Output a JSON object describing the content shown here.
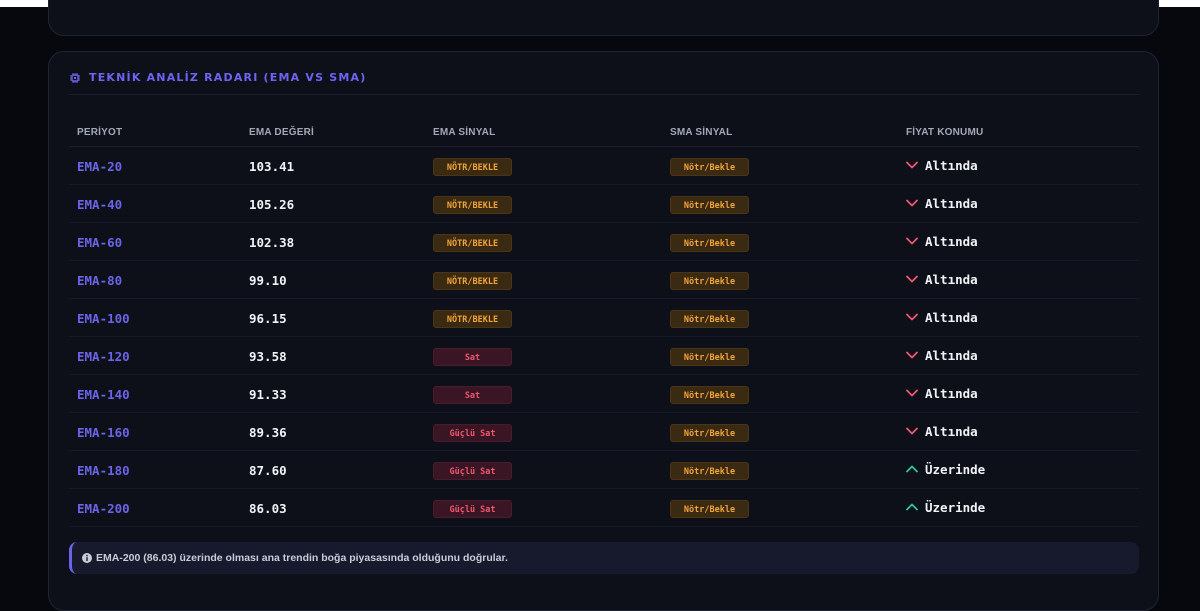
{
  "section": {
    "title": "TEKNİK ANALİZ RADARI (EMA VS SMA)",
    "icon": "chip-icon"
  },
  "table": {
    "headers": [
      "PERİYOT",
      "EMA DEĞERİ",
      "EMA SİNYAL",
      "SMA SİNYAL",
      "FİYAT KONUMU"
    ],
    "rows": [
      {
        "period": "EMA-20",
        "value": "103.41",
        "ema_signal": "NÖTR/BEKLE",
        "ema_kind": "neutral",
        "sma_signal": "Nötr/Bekle",
        "sma_kind": "neutral",
        "position": "Altında",
        "direction": "down"
      },
      {
        "period": "EMA-40",
        "value": "105.26",
        "ema_signal": "NÖTR/BEKLE",
        "ema_kind": "neutral",
        "sma_signal": "Nötr/Bekle",
        "sma_kind": "neutral",
        "position": "Altında",
        "direction": "down"
      },
      {
        "period": "EMA-60",
        "value": "102.38",
        "ema_signal": "NÖTR/BEKLE",
        "ema_kind": "neutral",
        "sma_signal": "Nötr/Bekle",
        "sma_kind": "neutral",
        "position": "Altında",
        "direction": "down"
      },
      {
        "period": "EMA-80",
        "value": "99.10",
        "ema_signal": "NÖTR/BEKLE",
        "ema_kind": "neutral",
        "sma_signal": "Nötr/Bekle",
        "sma_kind": "neutral",
        "position": "Altında",
        "direction": "down"
      },
      {
        "period": "EMA-100",
        "value": "96.15",
        "ema_signal": "NÖTR/BEKLE",
        "ema_kind": "neutral",
        "sma_signal": "Nötr/Bekle",
        "sma_kind": "neutral",
        "position": "Altında",
        "direction": "down"
      },
      {
        "period": "EMA-120",
        "value": "93.58",
        "ema_signal": "Sat",
        "ema_kind": "sell",
        "sma_signal": "Nötr/Bekle",
        "sma_kind": "neutral",
        "position": "Altında",
        "direction": "down"
      },
      {
        "period": "EMA-140",
        "value": "91.33",
        "ema_signal": "Sat",
        "ema_kind": "sell",
        "sma_signal": "Nötr/Bekle",
        "sma_kind": "neutral",
        "position": "Altında",
        "direction": "down"
      },
      {
        "period": "EMA-160",
        "value": "89.36",
        "ema_signal": "Güçlü Sat",
        "ema_kind": "sell",
        "sma_signal": "Nötr/Bekle",
        "sma_kind": "neutral",
        "position": "Altında",
        "direction": "down"
      },
      {
        "period": "EMA-180",
        "value": "87.60",
        "ema_signal": "Güçlü Sat",
        "ema_kind": "sell",
        "sma_signal": "Nötr/Bekle",
        "sma_kind": "neutral",
        "position": "Üzerinde",
        "direction": "up"
      },
      {
        "period": "EMA-200",
        "value": "86.03",
        "ema_signal": "Güçlü Sat",
        "ema_kind": "sell",
        "sma_signal": "Nötr/Bekle",
        "sma_kind": "neutral",
        "position": "Üzerinde",
        "direction": "up"
      }
    ]
  },
  "note": {
    "icon": "info-icon",
    "text": "EMA-200 (86.03) üzerinde olması ana trendin boğa piyasasında olduğunu doğrular."
  },
  "colors": {
    "accent": "#6b63e8",
    "neutral": "#f2a33a",
    "sell": "#f0566e",
    "down_arrow": "#f0566e",
    "up_arrow": "#2fc79a"
  }
}
